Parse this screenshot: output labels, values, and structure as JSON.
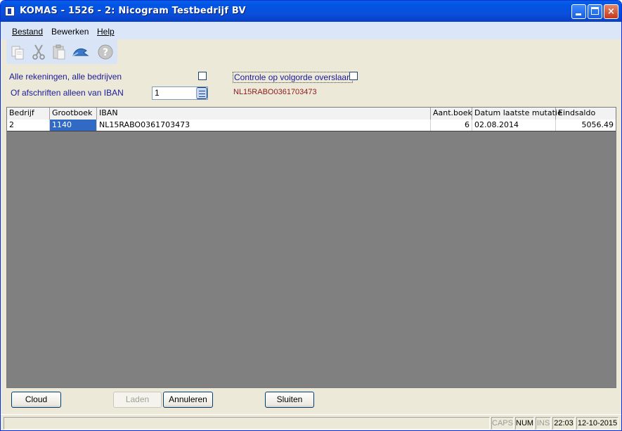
{
  "window": {
    "title": "KOMAS - 1526  - 2: Nicogram Testbedrijf BV",
    "minimize_label": "",
    "close_label": "×"
  },
  "menu": {
    "items": [
      {
        "label": "Bestand"
      },
      {
        "label": "Bewerken"
      },
      {
        "label": "Help"
      }
    ]
  },
  "toolbar": {
    "icons": [
      "copy-icon",
      "cut-icon",
      "paste-icon",
      "undo-icon",
      "help-icon"
    ]
  },
  "filters": {
    "all_accounts_label": "Alle rekeningen, alle bedrijven",
    "all_accounts_checked": false,
    "skip_order_check_label": "Controle op volgorde overslaan",
    "skip_order_check_checked": false,
    "iban_only_label": "Of afschriften alleen van IBAN",
    "iban_value": "1",
    "iban_display": "NL15RABO0361703473"
  },
  "table": {
    "columns": [
      "Bedrijf",
      "Grootboek",
      "IBAN",
      "Aant.boek",
      "Datum laatste mutatie",
      "Eindsaldo"
    ],
    "rows": [
      {
        "bedrijf": "2",
        "grootboek": "1140",
        "iban": "NL15RABO0361703473",
        "aant_boek": "6",
        "datum": "02.08.2014",
        "eindsaldo": "5056.49"
      }
    ]
  },
  "buttons": {
    "cloud": "Cloud",
    "laden": "Laden",
    "annuleren": "Annuleren",
    "sluiten": "Sluiten"
  },
  "status": {
    "caps": "CAPS",
    "num": "NUM",
    "ins": "INS",
    "time": "22:03",
    "date": "12-10-2015"
  },
  "colors": {
    "title_bar": "#0a4fdb",
    "selected_cell": "#316ac5",
    "iban_text": "#8b1a1a",
    "grid_background": "#808080"
  }
}
